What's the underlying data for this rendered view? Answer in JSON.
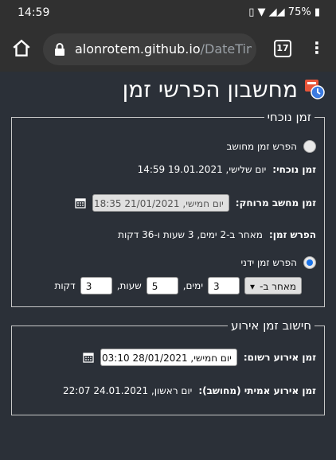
{
  "status": {
    "time": "14:59",
    "battery": "75%"
  },
  "browser": {
    "host": "alonrotem.github.io",
    "path": "/DateTim",
    "tab_count": "17"
  },
  "page": {
    "title": "מחשבון הפרשי זמן"
  },
  "current_time_section": {
    "legend": "זמן נוכחי",
    "computed_diff_label": "הפרש זמן מחושב",
    "now_label": "זמן נוכחי:",
    "now_value": "יום שלישי, 19.01.2021 14:59",
    "remote_label": "זמן מחשב מרוחק:",
    "remote_value": "יום חמישי, 21/01/2021 18:35",
    "diff_label": "הפרש זמן:",
    "diff_value": "מאחר ב-2 ימים, 3 שעות ו-36 דקות",
    "manual_diff_label": "הפרש זמן ידני",
    "direction_value": "מאחר ב-",
    "days_value": "3",
    "days_unit": "ימים,",
    "hours_value": "5",
    "hours_unit": "שעות,",
    "minutes_value": "3",
    "minutes_unit": "דקות"
  },
  "event_section": {
    "legend": "חישוב זמן אירוע",
    "recorded_label": "זמן אירוע רשום:",
    "recorded_value": "יום חמישי, 28/01/2021 03:10",
    "actual_label": "זמן אירוע אמיתי (מחושב):",
    "actual_value": "יום ראשון, 24.01.2021 22:07"
  }
}
